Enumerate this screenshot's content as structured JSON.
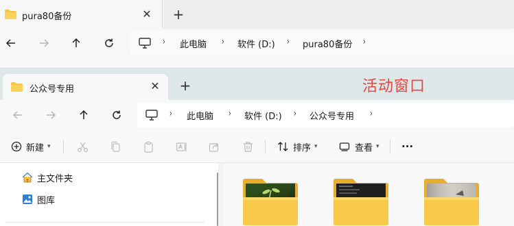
{
  "back_window": {
    "tab_title": "pura80备份",
    "breadcrumbs": [
      "此电脑",
      "软件 (D:)",
      "pura80备份"
    ]
  },
  "front_window": {
    "tab_title": "公众号专用",
    "annotation": "活动窗口",
    "breadcrumbs": [
      "此电脑",
      "软件 (D:)",
      "公众号专用"
    ],
    "toolbar": {
      "new_label": "新建",
      "sort_label": "排序",
      "view_label": "查看",
      "more_label": "···"
    },
    "sidebar": {
      "items": [
        {
          "label": "主文件夹",
          "icon": "home-icon"
        },
        {
          "label": "图库",
          "icon": "gallery-icon"
        }
      ]
    },
    "folders": [
      {
        "thumbnail": "plant-sprout-photo"
      },
      {
        "thumbnail": "dark-screenshot"
      },
      {
        "thumbnail": "gray-photo"
      }
    ]
  },
  "colors": {
    "annotation": "#e8453c",
    "folder_yellow": "#f5c54a",
    "active_tabbar": "#dee8ea"
  }
}
